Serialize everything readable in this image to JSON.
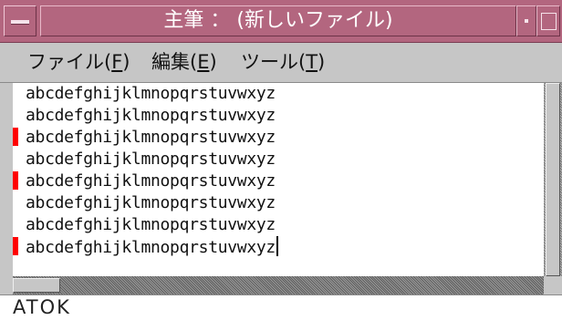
{
  "window": {
    "title": "主筆 ： (新しいファイル)"
  },
  "menubar": {
    "items": [
      {
        "label": "ファイル(",
        "mnemonic": "F",
        "suffix": ")"
      },
      {
        "label": "編集(",
        "mnemonic": "E",
        "suffix": ")"
      },
      {
        "label": "ツール(",
        "mnemonic": "T",
        "suffix": ")"
      }
    ]
  },
  "editor": {
    "lines": [
      "abcdefghijklmnopqrstuvwxyz",
      "abcdefghijklmnopqrstuvwxyz",
      "abcdefghijklmnopqrstuvwxyz",
      "abcdefghijklmnopqrstuvwxyz",
      "abcdefghijklmnopqrstuvwxyz",
      "abcdefghijklmnopqrstuvwxyz",
      "abcdefghijklmnopqrstuvwxyz",
      "abcdefghijklmnopqrstuvwxyz"
    ],
    "changed_lines": [
      3,
      5,
      8
    ]
  },
  "status": {
    "input_method": "ATOK"
  },
  "colors": {
    "titlebar": "#b3667f",
    "change_marker": "#ff0000"
  }
}
